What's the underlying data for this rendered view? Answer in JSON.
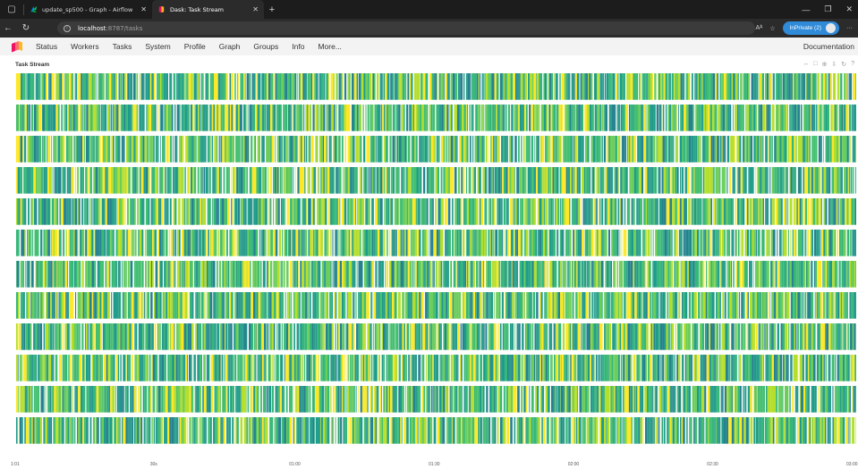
{
  "browser": {
    "tabs": [
      {
        "title": "update_sp500 - Graph - Airflow",
        "active": false
      },
      {
        "title": "Dask: Task Stream",
        "active": true
      }
    ],
    "url_host": "localhost",
    "url_path": ":8787/tasks",
    "inprivate_label": "InPrivate (2)",
    "read_aloud_label": "Aᴬ",
    "more_label": "···"
  },
  "dask_nav": {
    "items": [
      "Status",
      "Workers",
      "Tasks",
      "System",
      "Profile",
      "Graph",
      "Groups",
      "Info",
      "More..."
    ],
    "documentation": "Documentation"
  },
  "task_stream": {
    "title": "Task Stream",
    "toolbar_icons": [
      "pan-icon",
      "box-zoom-icon",
      "wheel-zoom-icon",
      "save-icon",
      "reset-icon",
      "help-icon"
    ]
  },
  "chart_data": {
    "type": "bar",
    "worker_rows": 12,
    "x_tick_labels": [
      "1:01",
      "30s",
      "01:00",
      "01:30",
      "02:00",
      "02:30",
      "03:00"
    ],
    "colors": [
      "#1f9c89",
      "#35b779",
      "#6ccd5a",
      "#b5de2b",
      "#fde725",
      "#26828e",
      "#2a9d8c",
      "#44bf70"
    ]
  }
}
